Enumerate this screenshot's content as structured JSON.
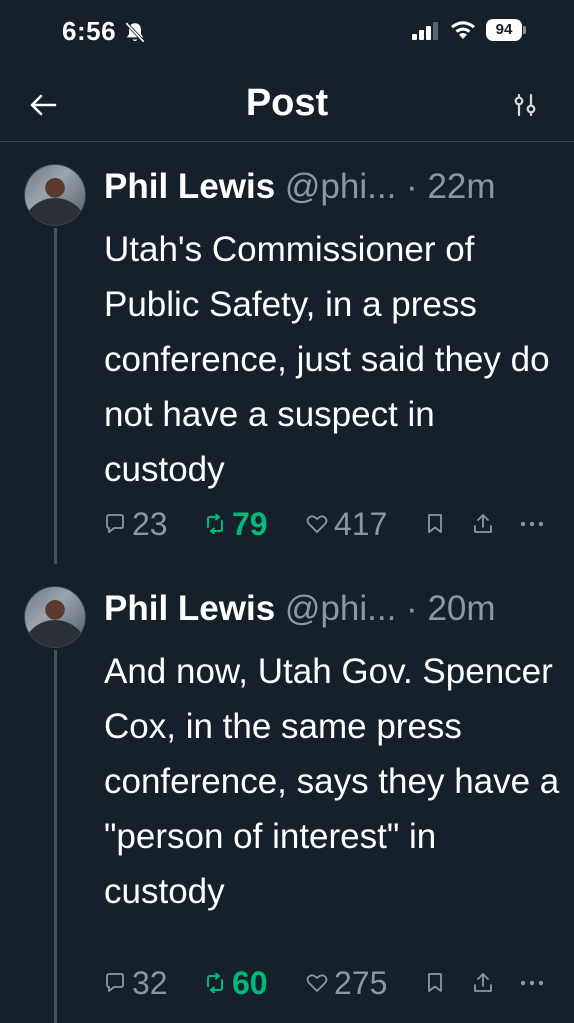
{
  "status_bar": {
    "time": "6:56",
    "battery": "94"
  },
  "header": {
    "title": "Post"
  },
  "tweets": [
    {
      "author_name": "Phil Lewis",
      "handle": "@phi...",
      "separator": "·",
      "time": "22m",
      "text": "Utah's Commissioner of Public Safety, in a press conference, just said they do not have a suspect in custody",
      "replies": "23",
      "retweets": "79",
      "likes": "417"
    },
    {
      "author_name": "Phil Lewis",
      "handle": "@phi...",
      "separator": "·",
      "time": "20m",
      "text": "And now, Utah Gov. Spencer Cox, in the same press conference, says they have a \"person of interest\" in custody",
      "replies": "32",
      "retweets": "60",
      "likes": "275"
    }
  ],
  "icons": {
    "back": "arrow-left-icon",
    "filter": "sliders-icon",
    "reply": "reply-icon",
    "retweet": "retweet-icon",
    "like": "heart-icon",
    "bookmark": "bookmark-icon",
    "share": "share-icon",
    "more": "more-icon"
  },
  "colors": {
    "background": "#15202b",
    "secondary_text": "#8899a6",
    "retweet_active": "#00ba7c",
    "divider": "#38444d"
  }
}
